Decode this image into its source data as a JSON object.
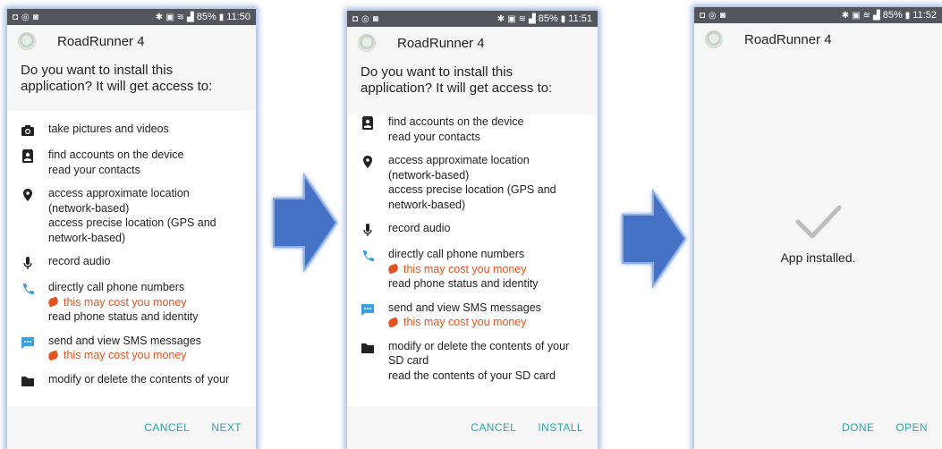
{
  "screens": [
    {
      "status": {
        "time": "11:50",
        "battery": "85%"
      },
      "app_name": "RoadRunner 4",
      "question": [
        "Do you want to install this",
        "application? It will get access to:"
      ],
      "perms": [
        {
          "icon": "camera-icon",
          "lines": [
            "take pictures and videos"
          ]
        },
        {
          "icon": "contacts-icon",
          "lines": [
            "find accounts on the device",
            "read your contacts"
          ]
        },
        {
          "icon": "location-pin-icon",
          "lines": [
            "access approximate location",
            "(network-based)",
            "access precise location (GPS and",
            "network-based)"
          ]
        },
        {
          "icon": "microphone-icon",
          "lines": [
            "record audio"
          ]
        },
        {
          "icon": "phone-icon",
          "lines": [
            "directly call phone numbers",
            "this may cost you money",
            "read phone status and identity"
          ],
          "money_index": 1
        },
        {
          "icon": "sms-icon",
          "lines": [
            "send and view SMS messages",
            "this may cost you money"
          ],
          "money_index": 1
        },
        {
          "icon": "folder-icon",
          "lines": [
            "modify or delete the contents of your"
          ]
        }
      ],
      "buttons": [
        "CANCEL",
        "NEXT"
      ]
    },
    {
      "status": {
        "time": "11:51",
        "battery": "85%"
      },
      "app_name": "RoadRunner 4",
      "question": [
        "Do you want to install this",
        "application? It will get access to:"
      ],
      "perms": [
        {
          "icon": "contacts-icon",
          "lines": [
            "find accounts on the device",
            "read your contacts"
          ]
        },
        {
          "icon": "location-pin-icon",
          "lines": [
            "access approximate location",
            "(network-based)",
            "access precise location (GPS and",
            "network-based)"
          ]
        },
        {
          "icon": "microphone-icon",
          "lines": [
            "record audio"
          ]
        },
        {
          "icon": "phone-icon",
          "lines": [
            "directly call phone numbers",
            "this may cost you money",
            "read phone status and identity"
          ],
          "money_index": 1
        },
        {
          "icon": "sms-icon",
          "lines": [
            "send and view SMS messages",
            "this may cost you money"
          ],
          "money_index": 1
        },
        {
          "icon": "folder-icon",
          "lines": [
            "modify or delete the contents of your",
            "SD card",
            "read the contents of your SD card"
          ]
        }
      ],
      "buttons": [
        "CANCEL",
        "INSTALL"
      ]
    },
    {
      "status": {
        "time": "11:52",
        "battery": "85%"
      },
      "app_name": "RoadRunner 4",
      "installed_text": "App installed.",
      "buttons": [
        "DONE",
        "OPEN"
      ]
    }
  ],
  "colors": {
    "accent": "#2aa6b0",
    "warning": "#e2531f",
    "arrow": "#4472c4"
  }
}
